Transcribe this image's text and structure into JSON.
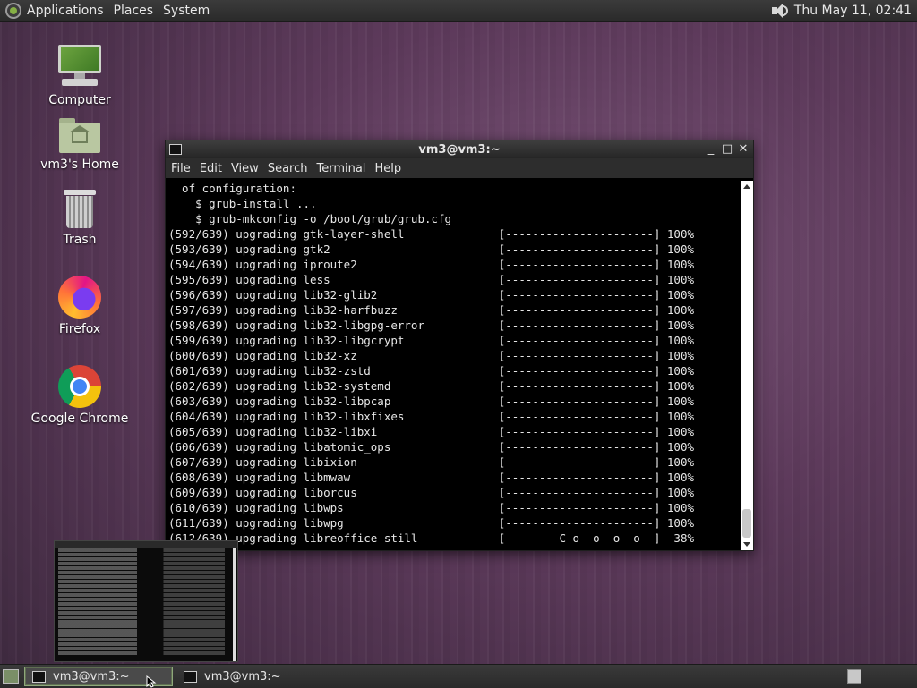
{
  "top_panel": {
    "menus": [
      "Applications",
      "Places",
      "System"
    ],
    "clock": "Thu May 11, 02:41"
  },
  "desktop_icons": [
    {
      "label": "Computer",
      "icon": "computer-icon"
    },
    {
      "label": "vm3's Home",
      "icon": "home-folder-icon"
    },
    {
      "label": "Trash",
      "icon": "trash-icon"
    },
    {
      "label": "Firefox",
      "icon": "firefox-icon"
    },
    {
      "label": "Google Chrome",
      "icon": "chrome-icon"
    }
  ],
  "window": {
    "title": "vm3@vm3:~",
    "controls": [
      "_",
      "□",
      "✕"
    ],
    "menu": [
      "File",
      "Edit",
      "View",
      "Search",
      "Terminal",
      "Help"
    ],
    "terminal_lines": [
      "  of configuration:",
      "    $ grub-install ...",
      "    $ grub-mkconfig -o /boot/grub/grub.cfg",
      "(592/639) upgrading gtk-layer-shell              [----------------------] 100%",
      "(593/639) upgrading gtk2                         [----------------------] 100%",
      "(594/639) upgrading iproute2                     [----------------------] 100%",
      "(595/639) upgrading less                         [----------------------] 100%",
      "(596/639) upgrading lib32-glib2                  [----------------------] 100%",
      "(597/639) upgrading lib32-harfbuzz               [----------------------] 100%",
      "(598/639) upgrading lib32-libgpg-error           [----------------------] 100%",
      "(599/639) upgrading lib32-libgcrypt              [----------------------] 100%",
      "(600/639) upgrading lib32-xz                     [----------------------] 100%",
      "(601/639) upgrading lib32-zstd                   [----------------------] 100%",
      "(602/639) upgrading lib32-systemd                [----------------------] 100%",
      "(603/639) upgrading lib32-libpcap                [----------------------] 100%",
      "(604/639) upgrading lib32-libxfixes              [----------------------] 100%",
      "(605/639) upgrading lib32-libxi                  [----------------------] 100%",
      "(606/639) upgrading libatomic_ops                [----------------------] 100%",
      "(607/639) upgrading libixion                     [----------------------] 100%",
      "(608/639) upgrading libmwaw                      [----------------------] 100%",
      "(609/639) upgrading liborcus                     [----------------------] 100%",
      "(610/639) upgrading libwps                       [----------------------] 100%",
      "(611/639) upgrading libwpg                       [----------------------] 100%",
      "(612/639) upgrading libreoffice-still            [--------C o  o  o  o  ]  38%"
    ]
  },
  "taskbar": {
    "tasks": [
      {
        "label": "vm3@vm3:~",
        "active": true
      },
      {
        "label": "vm3@vm3:~",
        "active": false
      }
    ]
  },
  "colors": {
    "panel": "#2e2e2e",
    "accent": "#8ea87a",
    "terminal_bg": "#000000",
    "terminal_fg": "#e6e6e6"
  }
}
